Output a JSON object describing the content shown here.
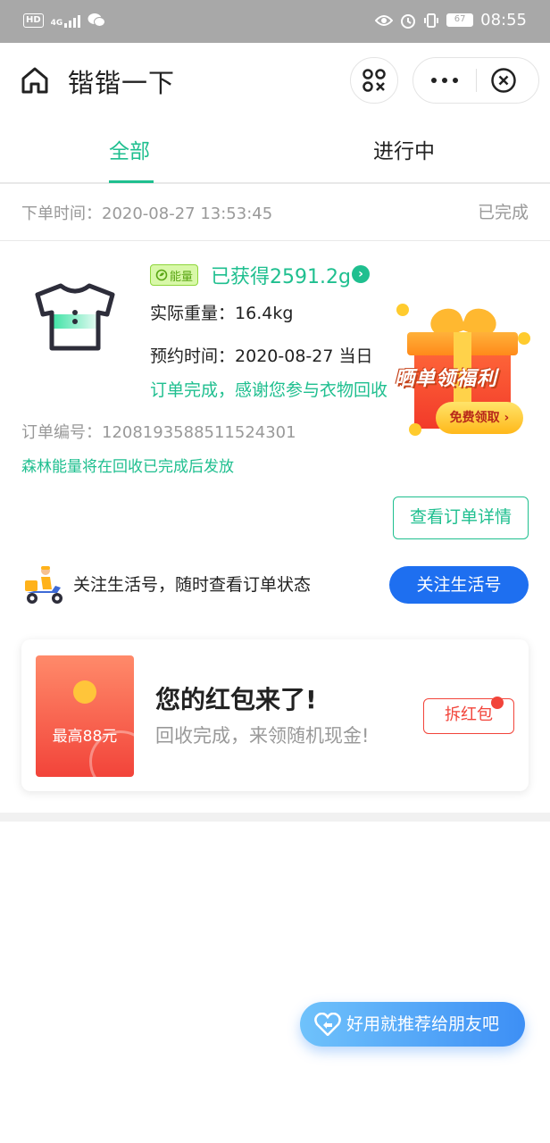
{
  "status_bar": {
    "hd": "HD",
    "network": "4G",
    "battery": "67",
    "time": "08:55"
  },
  "titlebar": {
    "title": "锴锴一下"
  },
  "tabs": [
    {
      "label": "全部",
      "active": true
    },
    {
      "label": "进行中",
      "active": false
    }
  ],
  "order": {
    "time_label": "下单时间：",
    "time_value": "2020-08-27 13:53:45",
    "status": "已完成",
    "energy_badge": "能量",
    "energy_gained": "已获得2591.2g",
    "weight_label": "实际重量：",
    "weight_value": "16.4kg",
    "appoint_label": "预约时间：",
    "appoint_value": "2020-08-27 当日",
    "thanks": "订单完成，感谢您参与衣物回收",
    "order_no_label": "订单编号：",
    "order_no": "1208193588511524301",
    "forest_note": "森林能量将在回收已完成后发放",
    "detail_button": "查看订单详情"
  },
  "promo": {
    "title": "晒单领福利",
    "button": "免费领取"
  },
  "follow": {
    "text": "关注生活号，随时查看订单状态",
    "button": "关注生活号"
  },
  "red_packet": {
    "max_amount": "最高88元",
    "title": "您的红包来了!",
    "subtitle": "回收完成，来领随机现金!",
    "button": "拆红包"
  },
  "recommend": {
    "text": "好用就推荐给朋友吧"
  },
  "colors": {
    "accent_green": "#1fbf8f",
    "accent_blue": "#1e6ff0",
    "accent_red": "#f2443a"
  }
}
